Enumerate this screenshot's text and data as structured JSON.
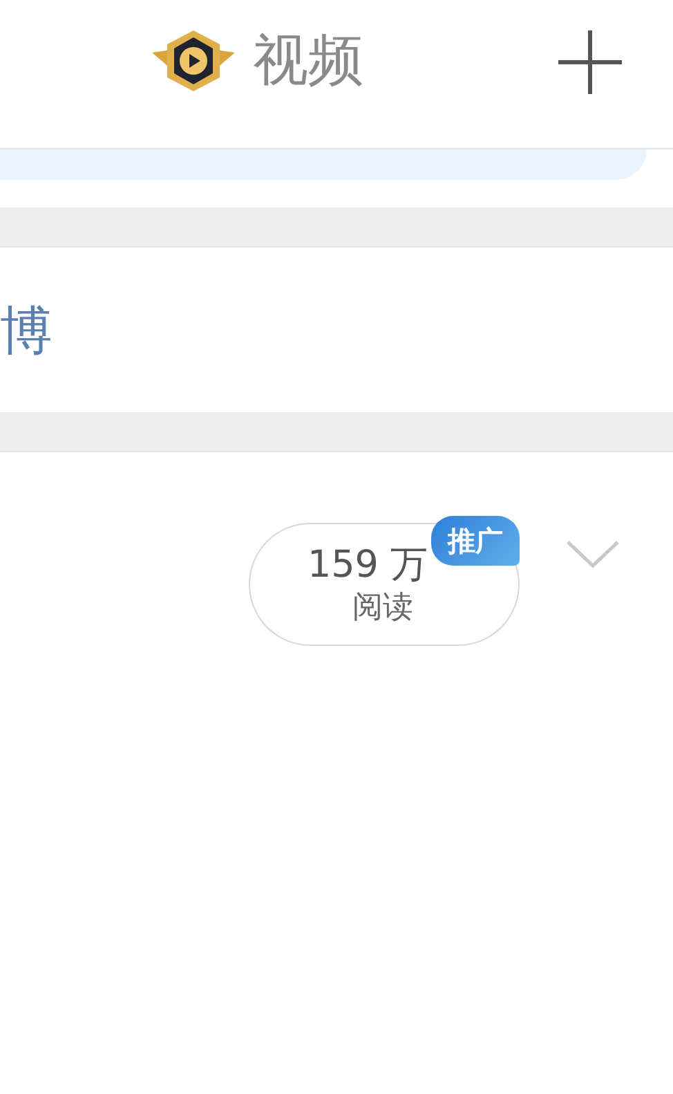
{
  "header": {
    "title": "视频"
  },
  "section": {
    "label": "博"
  },
  "post": {
    "read_count": "159 万",
    "read_label": "阅读",
    "badge": "推广"
  }
}
